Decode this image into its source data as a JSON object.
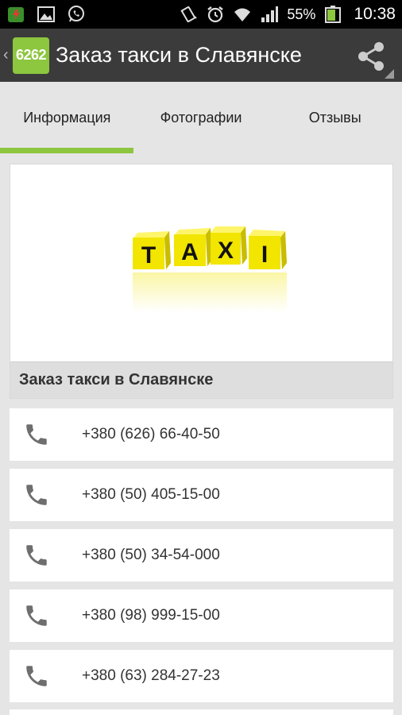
{
  "status_bar": {
    "battery_percent": "55%",
    "time": "10:38",
    "icons": [
      "app-notification-icon",
      "image-icon",
      "whatsapp-icon",
      "vibrate-icon",
      "alarm-icon",
      "wifi-icon",
      "signal-icon",
      "battery-icon"
    ]
  },
  "action_bar": {
    "logo_text": "6262",
    "title": "Заказ такси в Славянске",
    "share_icon": "share-icon"
  },
  "tabs": [
    {
      "label": "Информация",
      "selected": true
    },
    {
      "label": "Фотографии",
      "selected": false
    },
    {
      "label": "Отзывы",
      "selected": false
    }
  ],
  "card": {
    "image": {
      "letters": [
        "T",
        "A",
        "X",
        "I"
      ]
    },
    "title": "Заказ такси в Славянске"
  },
  "phones": [
    {
      "number": "+380 (626) 66-40-50"
    },
    {
      "number": "+380 (50) 405-15-00"
    },
    {
      "number": "+380 (50) 34-54-000"
    },
    {
      "number": "+380 (98) 999-15-00"
    },
    {
      "number": "+380 (63) 284-27-23"
    }
  ],
  "colors": {
    "accent": "#8dc63f",
    "action_bar": "#3b3b3b",
    "background": "#e5e5e5",
    "phone_icon": "#6e6e6e",
    "taxi_yellow": "#f2e500"
  }
}
